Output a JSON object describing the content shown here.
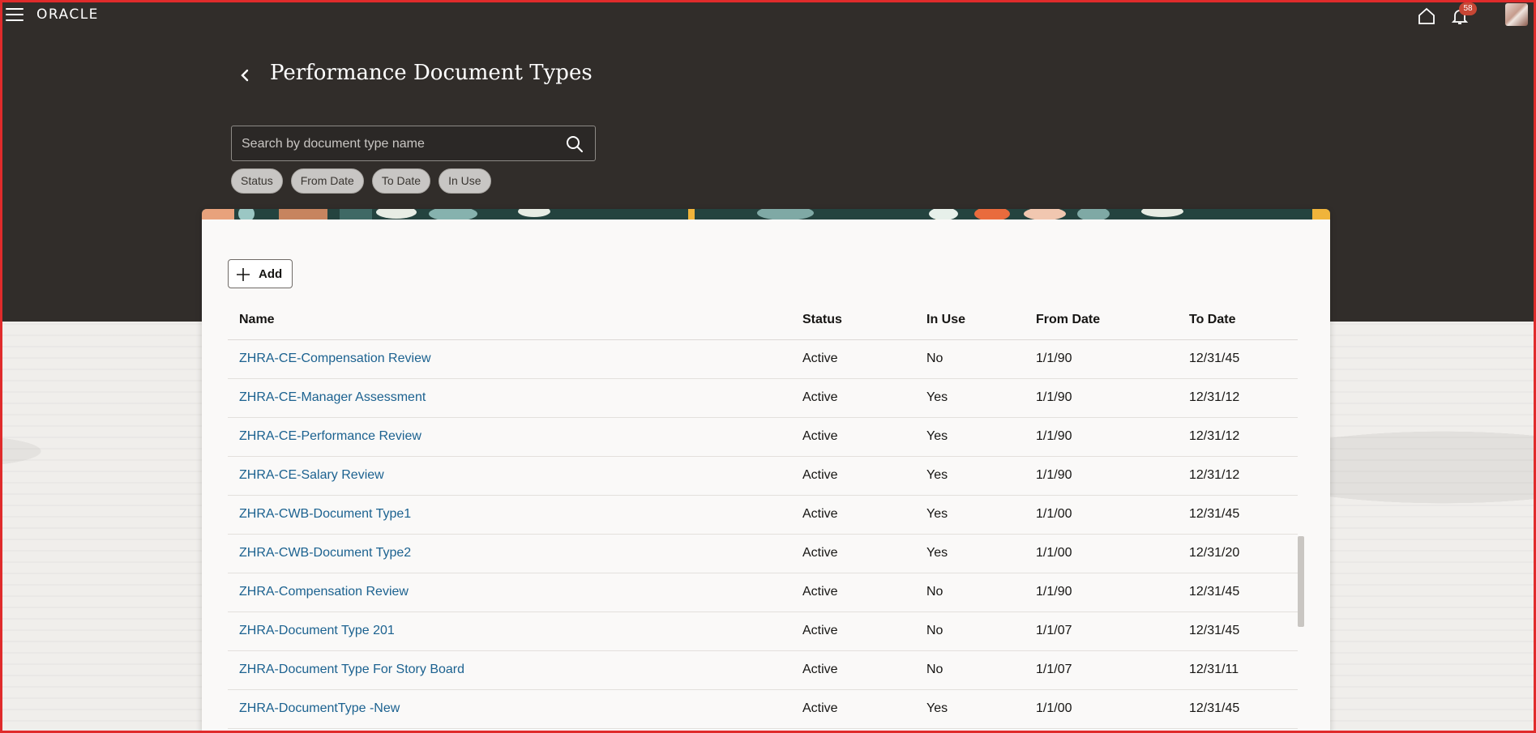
{
  "app": {
    "logo": "ORACLE",
    "notifications_count": "58"
  },
  "header": {
    "title": "Performance Document Types"
  },
  "search": {
    "placeholder": "Search by document type name"
  },
  "filters": [
    "Status",
    "From Date",
    "To Date",
    "In Use"
  ],
  "toolbar": {
    "add_label": "Add"
  },
  "table": {
    "columns": [
      "Name",
      "Status",
      "In Use",
      "From Date",
      "To Date"
    ],
    "rows": [
      {
        "name": "ZHRA-CE-Compensation Review",
        "status": "Active",
        "in_use": "No",
        "from": "1/1/90",
        "to": "12/31/45"
      },
      {
        "name": "ZHRA-CE-Manager Assessment",
        "status": "Active",
        "in_use": "Yes",
        "from": "1/1/90",
        "to": "12/31/12"
      },
      {
        "name": "ZHRA-CE-Performance Review",
        "status": "Active",
        "in_use": "Yes",
        "from": "1/1/90",
        "to": "12/31/12"
      },
      {
        "name": "ZHRA-CE-Salary Review",
        "status": "Active",
        "in_use": "Yes",
        "from": "1/1/90",
        "to": "12/31/12"
      },
      {
        "name": "ZHRA-CWB-Document Type1",
        "status": "Active",
        "in_use": "Yes",
        "from": "1/1/00",
        "to": "12/31/45"
      },
      {
        "name": "ZHRA-CWB-Document Type2",
        "status": "Active",
        "in_use": "Yes",
        "from": "1/1/00",
        "to": "12/31/20"
      },
      {
        "name": "ZHRA-Compensation Review",
        "status": "Active",
        "in_use": "No",
        "from": "1/1/90",
        "to": "12/31/45"
      },
      {
        "name": "ZHRA-Document Type 201",
        "status": "Active",
        "in_use": "No",
        "from": "1/1/07",
        "to": "12/31/45"
      },
      {
        "name": "ZHRA-Document Type For Story Board",
        "status": "Active",
        "in_use": "No",
        "from": "1/1/07",
        "to": "12/31/11"
      },
      {
        "name": "ZHRA-DocumentType -New",
        "status": "Active",
        "in_use": "Yes",
        "from": "1/1/00",
        "to": "12/31/45"
      }
    ]
  },
  "icons": {
    "menu": "hamburger-icon",
    "home": "home-icon",
    "notifications": "bell-icon",
    "back": "chevron-left-icon",
    "search": "search-icon",
    "add": "plus-icon"
  },
  "colors": {
    "header_bg": "#312d2a",
    "link": "#1c6290",
    "badge": "#c74634",
    "frame": "#e02b2b"
  }
}
